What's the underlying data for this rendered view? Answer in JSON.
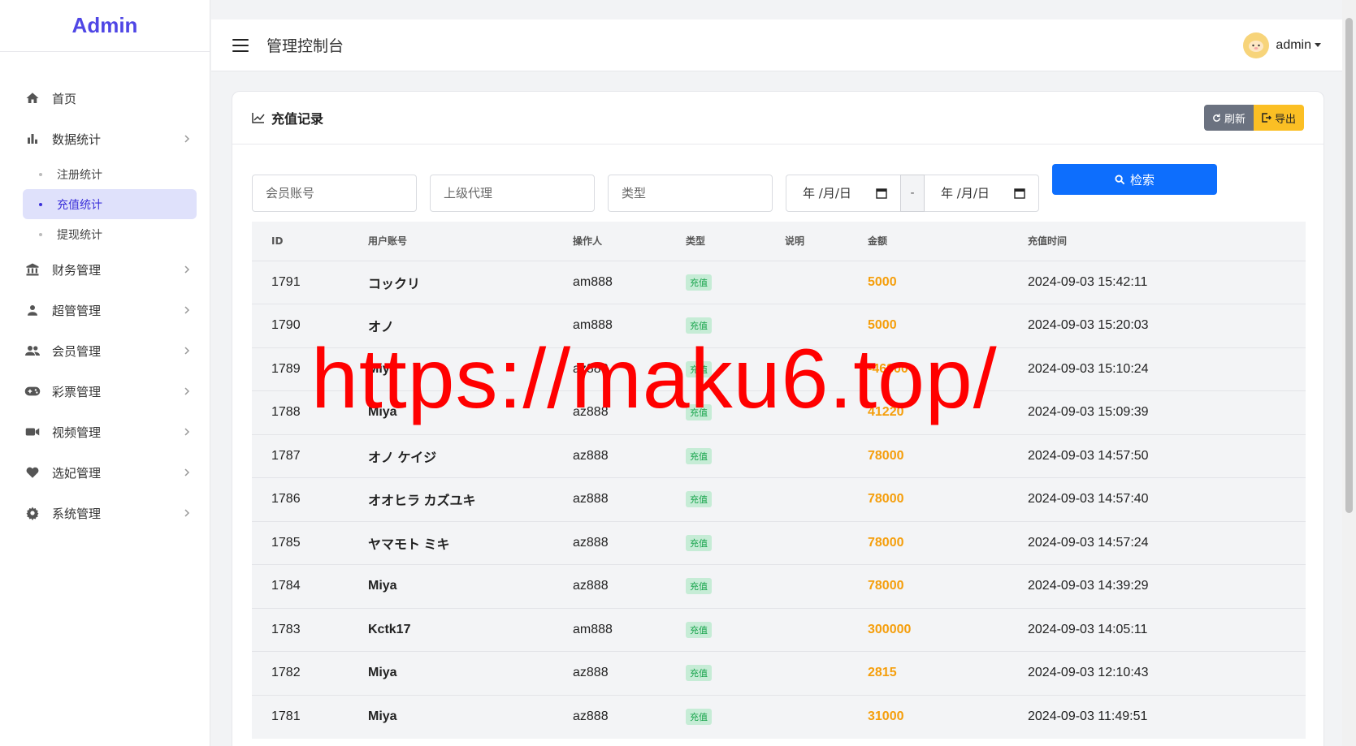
{
  "brand": "Admin",
  "sidebar": {
    "items": [
      {
        "label": "首页",
        "icon": "home-icon"
      },
      {
        "label": "数据统计",
        "icon": "bar-chart-icon"
      },
      {
        "label": "财务管理",
        "icon": "bank-icon"
      },
      {
        "label": "超管管理",
        "icon": "person-icon"
      },
      {
        "label": "会员管理",
        "icon": "group-icon"
      },
      {
        "label": "彩票管理",
        "icon": "gamepad-icon"
      },
      {
        "label": "视频管理",
        "icon": "video-icon"
      },
      {
        "label": "选妃管理",
        "icon": "heart-icon"
      },
      {
        "label": "系统管理",
        "icon": "gear-icon"
      }
    ],
    "sub_items": [
      {
        "label": "注册统计"
      },
      {
        "label": "充值统计",
        "active": true
      },
      {
        "label": "提现统计"
      }
    ]
  },
  "header": {
    "title": "管理控制台",
    "user": "admin"
  },
  "card": {
    "title": "充值记录",
    "refresh_label": "刷新",
    "export_label": "导出"
  },
  "filters": {
    "member_placeholder": "会员账号",
    "agent_placeholder": "上级代理",
    "type_placeholder": "类型",
    "date_from": "年 /月/日",
    "date_sep": "-",
    "date_to": "年 /月/日",
    "search_label": "检索"
  },
  "table": {
    "headers": [
      "ID",
      "用户账号",
      "操作人",
      "类型",
      "说明",
      "金额",
      "充值时间"
    ],
    "rows": [
      {
        "id": "1791",
        "user": "コックリ",
        "operator": "am888",
        "type": "充值",
        "note": "",
        "amount": "5000",
        "time": "2024-09-03 15:42:11"
      },
      {
        "id": "1790",
        "user": "オノ",
        "operator": "am888",
        "type": "充值",
        "note": "",
        "amount": "5000",
        "time": "2024-09-03 15:20:03"
      },
      {
        "id": "1789",
        "user": "Miya",
        "operator": "az888",
        "type": "充值",
        "note": "",
        "amount": "-46800",
        "time": "2024-09-03 15:10:24"
      },
      {
        "id": "1788",
        "user": "Miya",
        "operator": "az888",
        "type": "充值",
        "note": "",
        "amount": "41220",
        "time": "2024-09-03 15:09:39"
      },
      {
        "id": "1787",
        "user": "オノ ケイジ",
        "operator": "az888",
        "type": "充值",
        "note": "",
        "amount": "78000",
        "time": "2024-09-03 14:57:50"
      },
      {
        "id": "1786",
        "user": "オオヒラ カズユキ",
        "operator": "az888",
        "type": "充值",
        "note": "",
        "amount": "78000",
        "time": "2024-09-03 14:57:40"
      },
      {
        "id": "1785",
        "user": "ヤマモト ミキ",
        "operator": "az888",
        "type": "充值",
        "note": "",
        "amount": "78000",
        "time": "2024-09-03 14:57:24"
      },
      {
        "id": "1784",
        "user": "Miya",
        "operator": "az888",
        "type": "充值",
        "note": "",
        "amount": "78000",
        "time": "2024-09-03 14:39:29"
      },
      {
        "id": "1783",
        "user": "Kctk17",
        "operator": "am888",
        "type": "充值",
        "note": "",
        "amount": "300000",
        "time": "2024-09-03 14:05:11"
      },
      {
        "id": "1782",
        "user": "Miya",
        "operator": "az888",
        "type": "充值",
        "note": "",
        "amount": "2815",
        "time": "2024-09-03 12:10:43"
      },
      {
        "id": "1781",
        "user": "Miya",
        "operator": "az888",
        "type": "充值",
        "note": "",
        "amount": "31000",
        "time": "2024-09-03 11:49:51"
      }
    ]
  },
  "watermark": "https://maku6.top/",
  "colors": {
    "accent": "#4f46e5",
    "primary": "#0d6efd",
    "amount": "#f59e0b",
    "export": "#fbbf24"
  }
}
